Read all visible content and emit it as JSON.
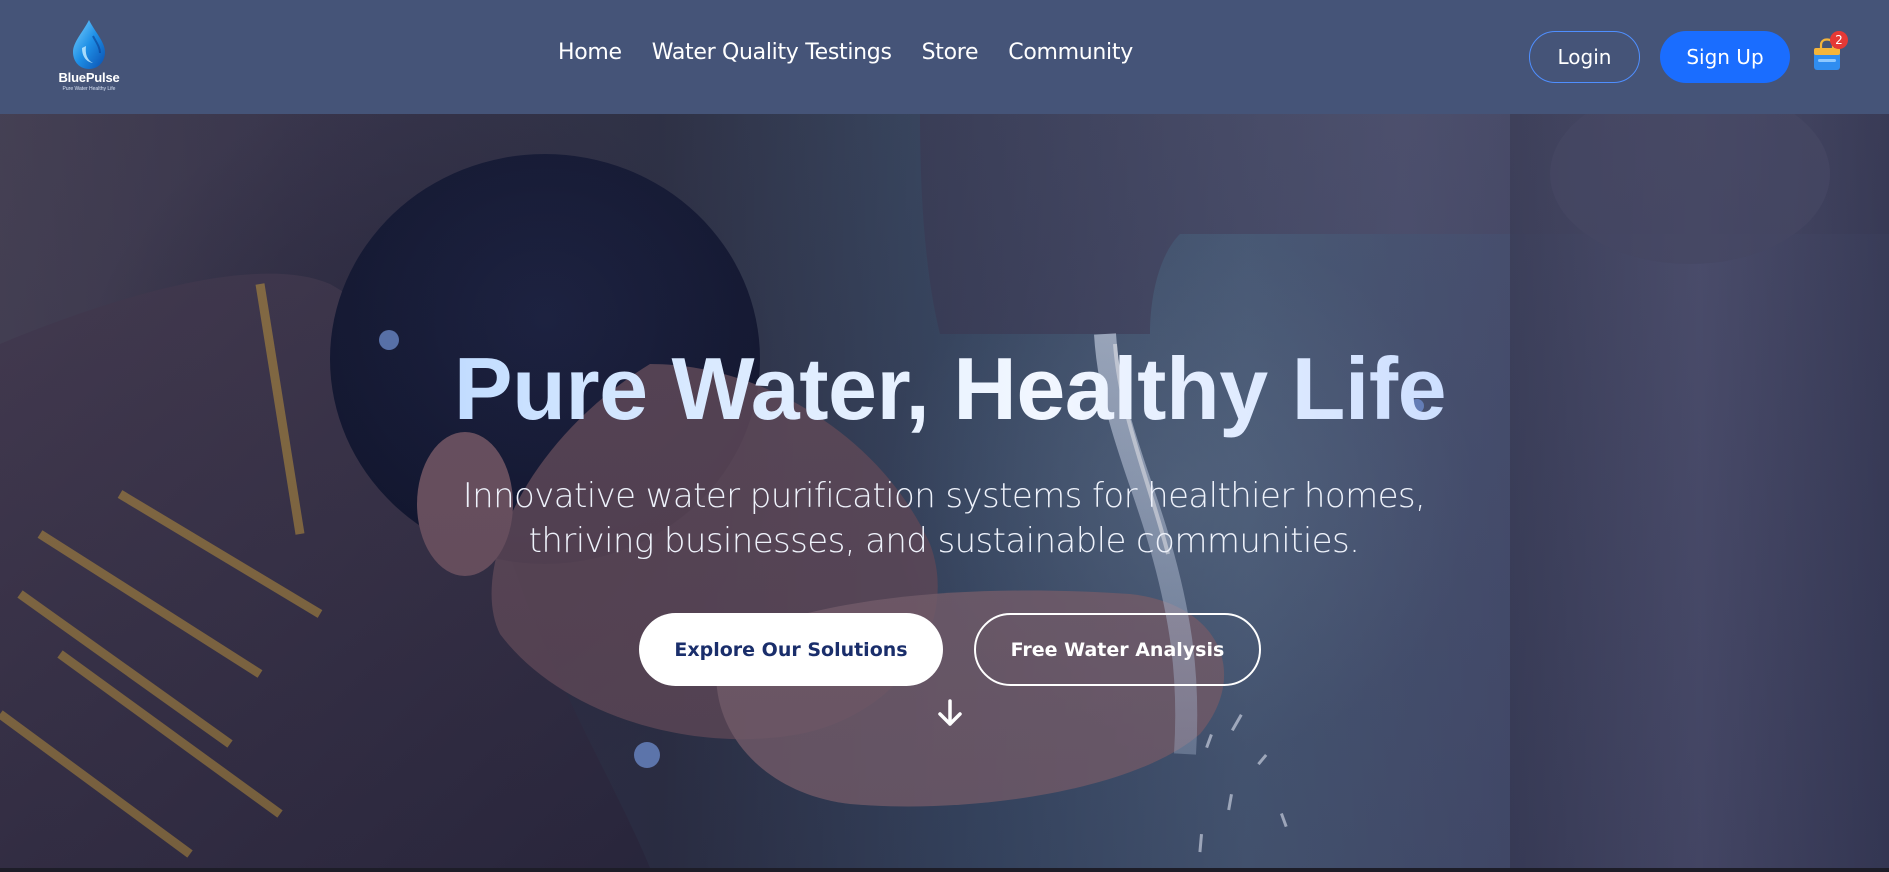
{
  "brand": {
    "name": "BluePulse",
    "tagline": "Pure Water Healthy Life",
    "icon": "water-drop-logo-icon"
  },
  "nav": {
    "links": [
      "Home",
      "Water Quality Testings",
      "Store",
      "Community"
    ]
  },
  "auth": {
    "login_label": "Login",
    "signup_label": "Sign Up"
  },
  "cart": {
    "icon": "shopping-bag-icon",
    "count": "2"
  },
  "hero": {
    "title": "Pure Water, Healthy Life",
    "subtitle_line1": "Innovative water purification systems for healthier homes,",
    "subtitle_line2": "thriving businesses, and sustainable communities.",
    "primary_button": "Explore Our Solutions",
    "secondary_button": "Free Water Analysis",
    "scroll_icon": "arrow-down-icon"
  },
  "colors": {
    "navbar": "#455478",
    "signup_button": "#1a6dff",
    "login_border": "#4f8fff",
    "primary_button_text": "#1a2e6b",
    "badge": "#e53935"
  }
}
